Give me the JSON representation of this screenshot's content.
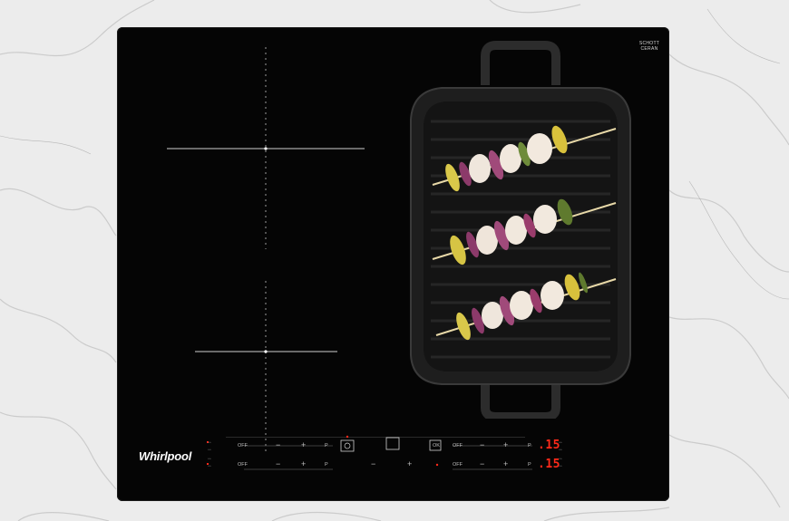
{
  "scene": {
    "description_colors": {
      "marble": "#e9e9e9",
      "glass": "#050505",
      "display": "#ff2a1a",
      "controls": "#bdbdbd"
    }
  },
  "hob": {
    "brand": "Whirlpool",
    "glass_maker_line1": "SCHOTT",
    "glass_maker_line2": "CERAN"
  },
  "controls": {
    "left_top": {
      "off": "OFF",
      "minus": "−",
      "plus": "+",
      "p": "P"
    },
    "left_bottom": {
      "off": "OFF",
      "minus": "−",
      "plus": "+",
      "p": "P"
    },
    "right_top": {
      "off": "OFF",
      "minus": "−",
      "plus": "+",
      "p": "P",
      "display": ".15"
    },
    "right_bottom": {
      "off": "OFF",
      "minus": "−",
      "plus": "+",
      "p": "P",
      "display": ".15"
    },
    "center_minus": "−",
    "center_plus": "+",
    "ok": "OK"
  },
  "icons": [
    "timer-icon",
    "power-icon",
    "lock-icon",
    "cooking-zone-icon",
    "grill-pan-icon",
    "skewer-icon"
  ]
}
